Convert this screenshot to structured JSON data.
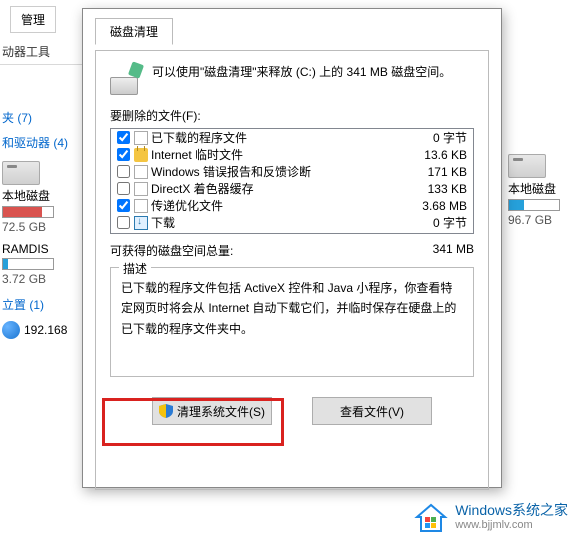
{
  "bg": {
    "tab_manage": "管理",
    "tools_label": "动器工具",
    "group_folders": "夹 (7)",
    "group_drives": "和驱动器 (4)",
    "group_location": "立置 (1)",
    "drive_local": "本地磁盘",
    "drive_local_size": "72.5 GB",
    "drive_ramdisk": "RAMDIS",
    "drive_ramdisk_size": "3.72 GB",
    "network_ip": "192.168",
    "right_drive": "本地磁盘",
    "right_drive_size": "96.7 GB"
  },
  "dialog": {
    "tab": "磁盘清理",
    "intro": "可以使用\"磁盘清理\"来释放  (C:) 上的 341 MB 磁盘空间。",
    "files_to_delete_label": "要删除的文件(F):",
    "items": [
      {
        "checked": true,
        "icon": "page",
        "name": "已下载的程序文件",
        "size": "0 字节"
      },
      {
        "checked": true,
        "icon": "lock",
        "name": "Internet 临时文件",
        "size": "13.6 KB"
      },
      {
        "checked": false,
        "icon": "page",
        "name": "Windows 错误报告和反馈诊断",
        "size": "171 KB"
      },
      {
        "checked": false,
        "icon": "page",
        "name": "DirectX 着色器缓存",
        "size": "133 KB"
      },
      {
        "checked": true,
        "icon": "page",
        "name": "传递优化文件",
        "size": "3.68 MB"
      },
      {
        "checked": false,
        "icon": "down",
        "name": "下载",
        "size": "0 字节"
      }
    ],
    "total_label": "可获得的磁盘空间总量:",
    "total_value": "341 MB",
    "desc_legend": "描述",
    "desc_text": "已下载的程序文件包括 ActiveX 控件和 Java 小程序，你查看特定网页时将会从 Internet 自动下载它们，并临时保存在硬盘上的已下载的程序文件夹中。",
    "btn_clean_system": "清理系统文件(S)",
    "btn_view_files": "查看文件(V)"
  },
  "watermark": {
    "line1": "Windows系统之家",
    "line2": "www.bjjmlv.com"
  }
}
